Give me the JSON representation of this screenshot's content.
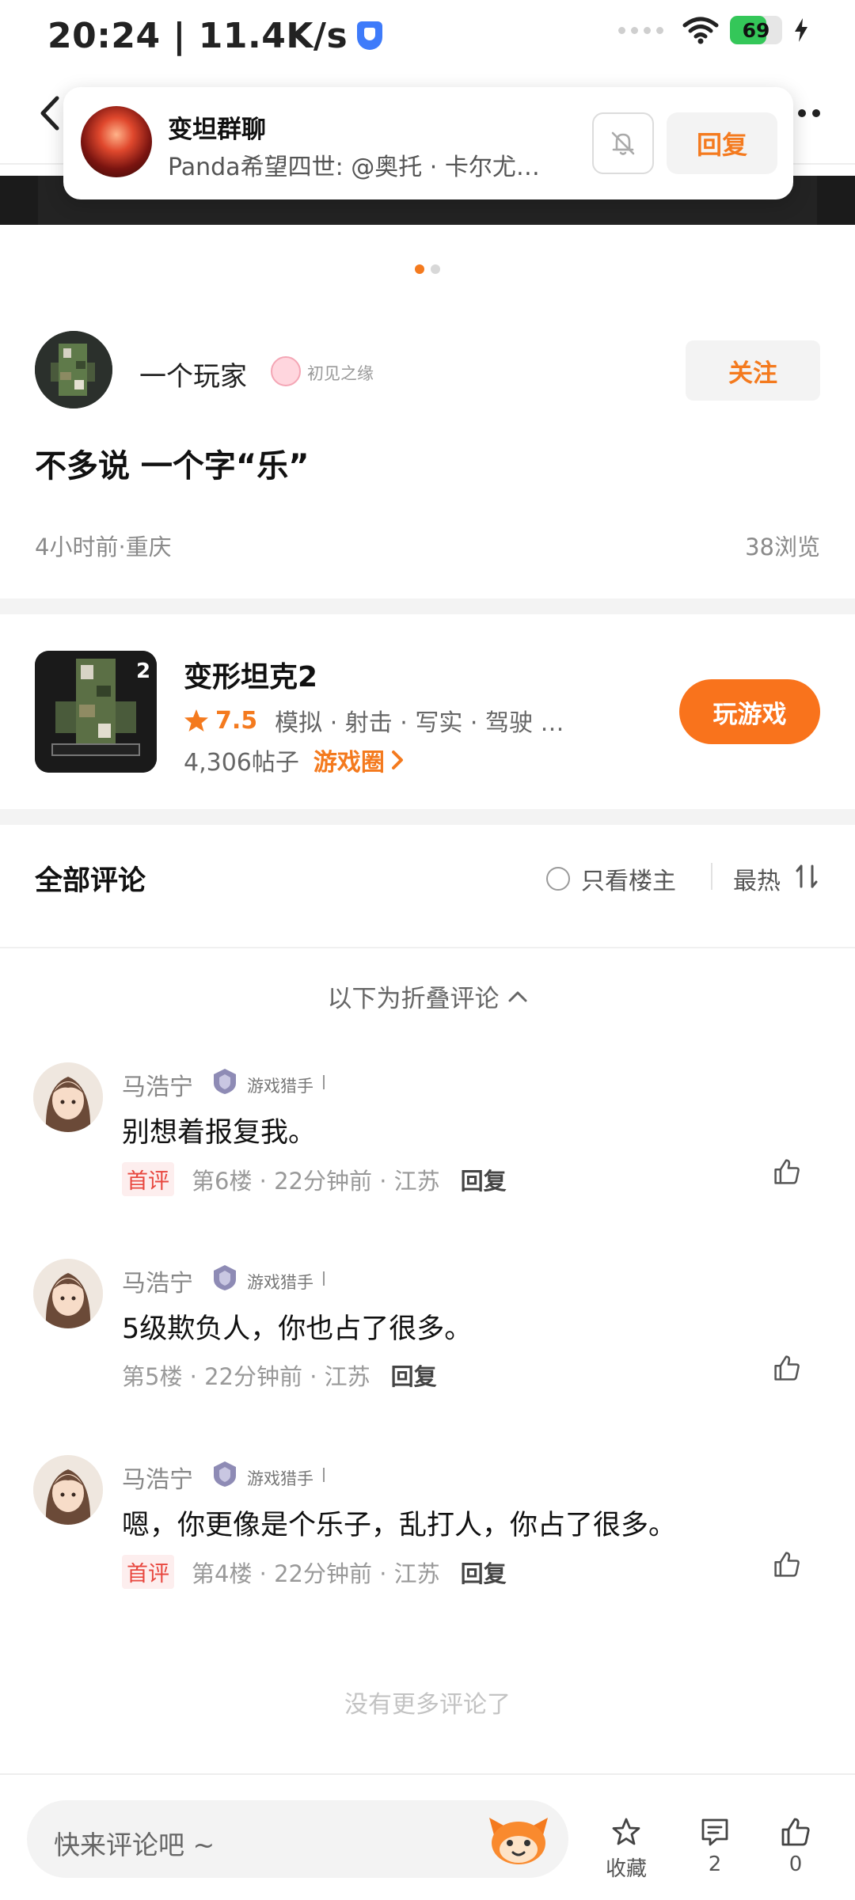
{
  "status_bar": {
    "time": "20:24 | 11.4K/s",
    "battery": "69",
    "battery_level_percent": 69
  },
  "notification": {
    "title": "变坦群聊",
    "message": "Panda希望四世: @奥托 · 卡尔尤…",
    "reply_label": "回复",
    "mute_icon": "bell-off-icon"
  },
  "banner": {
    "page_index": 0,
    "page_count": 2
  },
  "author": {
    "name": "一个玩家",
    "badge": "初见之缘",
    "follow_label": "关注"
  },
  "post": {
    "title": "不多说 一个字“乐”",
    "meta": "4小时前·重庆",
    "views": "38浏览"
  },
  "game": {
    "name": "变形坦克2",
    "rating": "7.5",
    "tags": "模拟 · 射击 · 写实 · 驾驶 …",
    "posts": "4,306帖子",
    "circle_label": "游戏圈",
    "play_label": "玩游戏"
  },
  "comments_header": {
    "title": "全部评论",
    "only_op": "只看楼主",
    "sort": "最热"
  },
  "fold_label": "以下为折叠评论",
  "comments": [
    {
      "name": "马浩宁",
      "badge": "游戏猎手",
      "text": "别想着报复我。",
      "first_tag": "首评",
      "meta": "第6楼 · 22分钟前 · 江苏",
      "reply": "回复"
    },
    {
      "name": "马浩宁",
      "badge": "游戏猎手",
      "text": "5级欺负人，你也占了很多。",
      "first_tag": "",
      "meta": "第5楼 · 22分钟前 · 江苏",
      "reply": "回复"
    },
    {
      "name": "马浩宁",
      "badge": "游戏猎手",
      "text": "嗯，你更像是个乐子，乱打人，你占了很多。",
      "first_tag": "首评",
      "meta": "第4楼 · 22分钟前 · 江苏",
      "reply": "回复"
    }
  ],
  "no_more": "没有更多评论了",
  "bottom_bar": {
    "input_placeholder": "快来评论吧 ~",
    "favorite_label": "收藏",
    "comment_count": "2",
    "like_count": "0"
  },
  "colors": {
    "accent": "#f47a1e",
    "play_button": "#f9731c",
    "first_tag_text": "#e8473f",
    "battery_fill": "#34c759",
    "shield": "#3e7bfa"
  }
}
